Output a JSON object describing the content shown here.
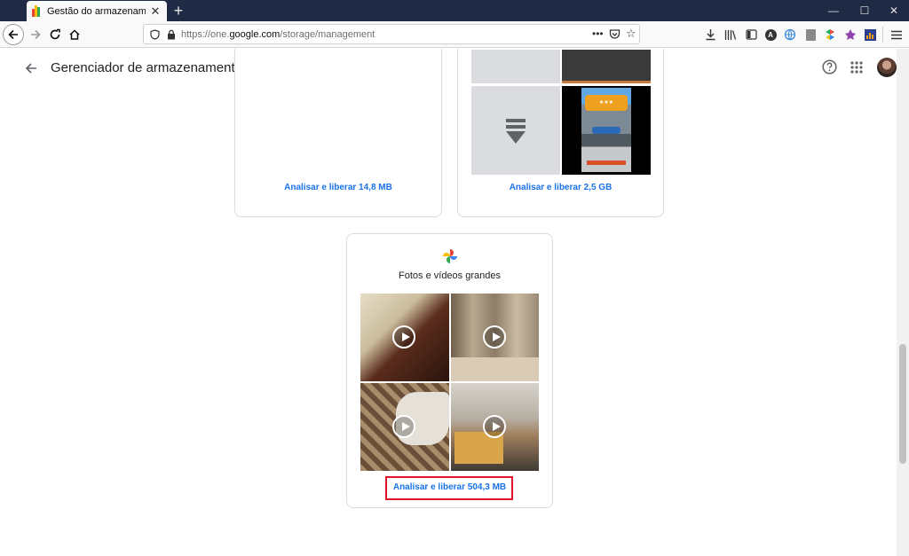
{
  "browser": {
    "tab_title": "Gestão do armazenamento do Go",
    "url_prefix": "https://one.",
    "url_domain": "google.com",
    "url_path": "/storage/management"
  },
  "app": {
    "title": "Gerenciador de armazenamento"
  },
  "cards": {
    "card1_link": "Analisar e liberar 14,8 MB",
    "card2_link": "Analisar e liberar 2,5 GB",
    "photos_heading": "Fotos e vídeos grandes",
    "photos_link": "Analisar e liberar 504,3 MB"
  },
  "icons": {
    "back": "arrow-left-icon",
    "help": "help-icon",
    "apps": "apps-grid-icon",
    "avatar": "avatar",
    "play": "play-icon"
  },
  "colors": {
    "link": "#1a73e8",
    "highlight": "#e0112b",
    "titlebar": "#1f2a44"
  }
}
